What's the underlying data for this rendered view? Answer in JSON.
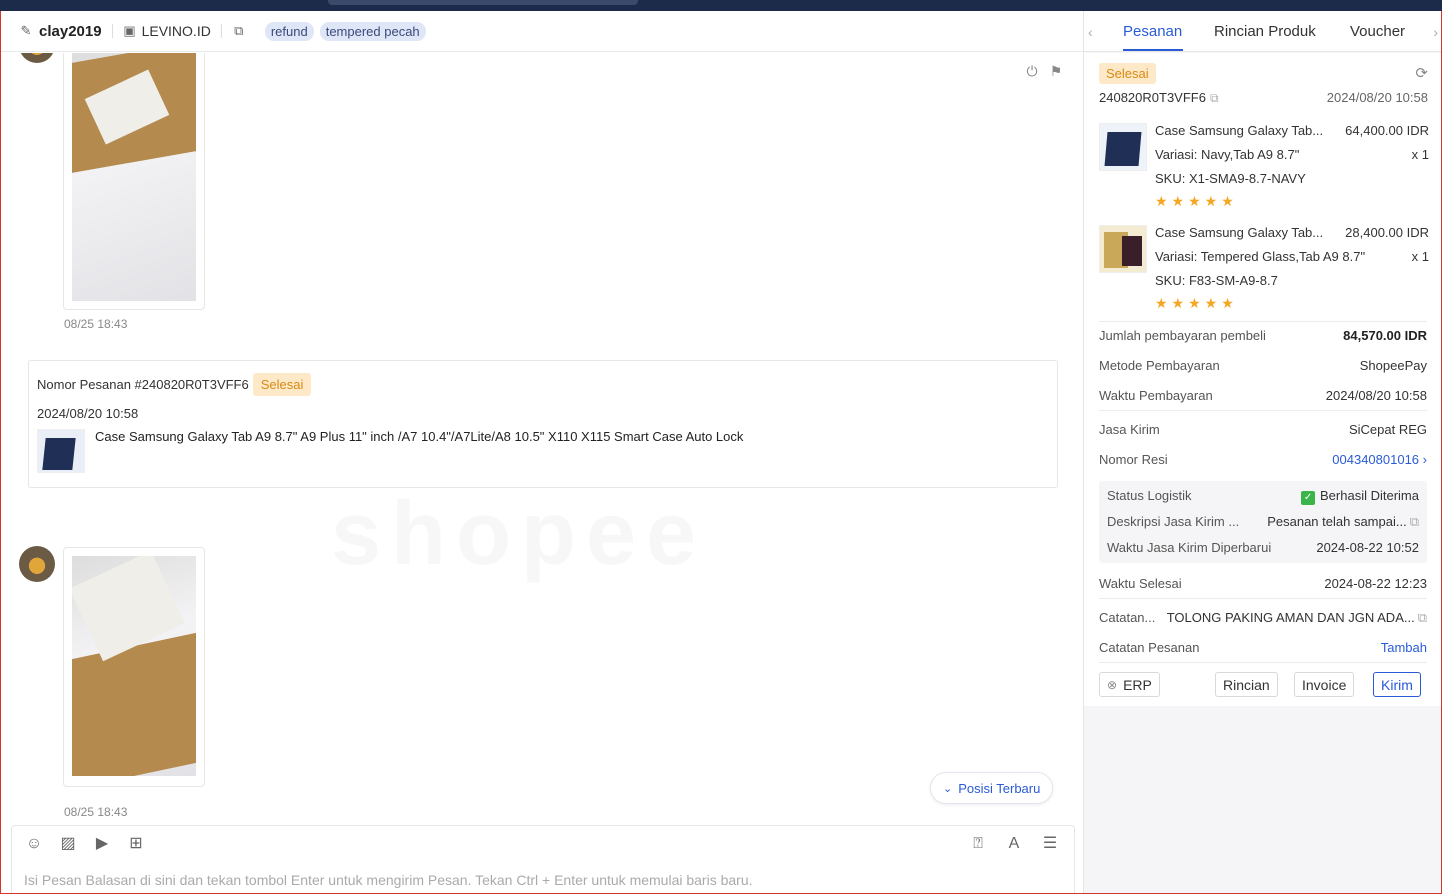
{
  "header": {
    "username": "clay2019",
    "shop": "LEVINO.ID",
    "tags": [
      "refund",
      "tempered pecah"
    ]
  },
  "messages": {
    "image1_time": "08/25 18:43",
    "image2_time": "08/25 18:43",
    "order_card": {
      "label": "Nomor Pesanan #240820R0T3VFF6",
      "status": "Selesai",
      "date": "2024/08/20 10:58",
      "product": "Case Samsung Galaxy Tab A9 8.7\" A9 Plus 11\" inch /A7 10.4\"/A7Lite/A8 10.5\" X110 X115 Smart Case Auto Lock"
    },
    "posisi_label": "Posisi Terbaru"
  },
  "composer": {
    "placeholder": "Isi Pesan Balasan di sini dan tekan tombol Enter untuk mengirim Pesan. Tekan Ctrl + Enter untuk memulai baris baru."
  },
  "right_panel": {
    "tabs": [
      "Pesanan",
      "Rincian Produk",
      "Voucher"
    ],
    "status": "Selesai",
    "order_id": "240820R0T3VFF6",
    "order_date": "2024/08/20 10:58",
    "products": [
      {
        "name": "Case Samsung Galaxy Tab...",
        "price": "64,400.00 IDR",
        "variation": "Variasi:  Navy,Tab A9 8.7\"",
        "qty": "x 1",
        "sku": "SKU:  X1-SMA9-8.7-NAVY",
        "stars": "★★★★★"
      },
      {
        "name": "Case Samsung Galaxy Tab...",
        "price": "28,400.00 IDR",
        "variation": "Variasi:  Tempered Glass,Tab A9 8.7\"",
        "qty": "x 1",
        "sku": "SKU:  F83-SM-A9-8.7",
        "stars": "★★★★★"
      }
    ],
    "rows": {
      "payment_amount_label": "Jumlah pembayaran pembeli",
      "payment_amount": "84,570.00 IDR",
      "payment_method_label": "Metode Pembayaran",
      "payment_method": "ShopeePay",
      "payment_time_label": "Waktu Pembayaran",
      "payment_time": "2024/08/20 10:58",
      "courier_label": "Jasa Kirim",
      "courier": "SiCepat REG",
      "resi_label": "Nomor Resi",
      "resi": "004340801016",
      "logistic_status_label": "Status Logistik",
      "logistic_status": "Berhasil Diterima",
      "courier_desc_label": "Deskripsi Jasa Kirim ...",
      "courier_desc": "Pesanan telah sampai...",
      "courier_update_label": "Waktu Jasa Kirim Diperbarui",
      "courier_update": "2024-08-22 10:52",
      "finish_time_label": "Waktu Selesai",
      "finish_time": "2024-08-22 12:23",
      "note_label": "Catatan...",
      "note": "TOLONG PAKING AMAN DAN JGN ADA...",
      "order_note_label": "Catatan Pesanan",
      "order_note_action": "Tambah"
    },
    "buttons": {
      "erp": "ERP",
      "rincian": "Rincian",
      "invoice": "Invoice",
      "kirim": "Kirim"
    }
  }
}
